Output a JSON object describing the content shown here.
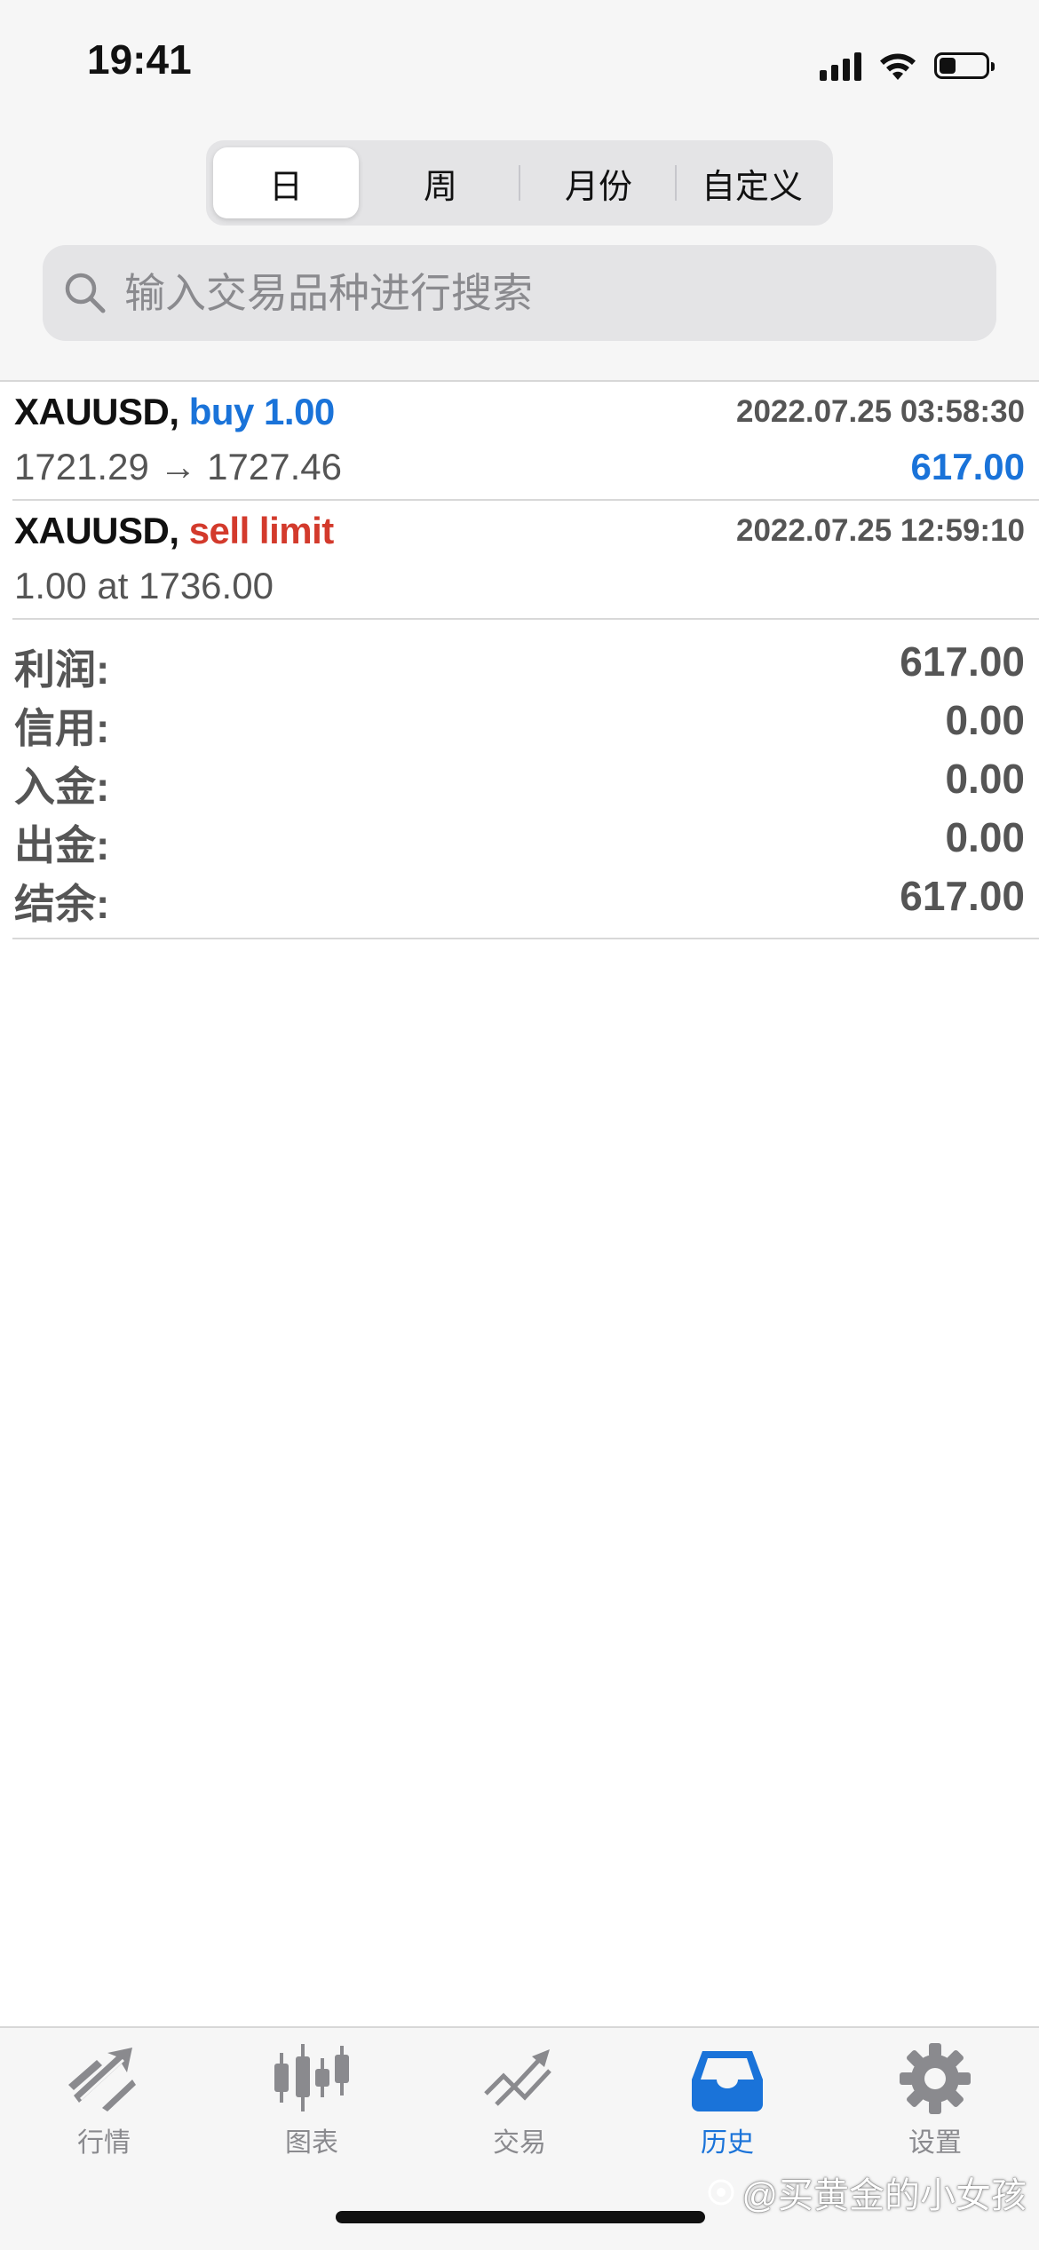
{
  "status_bar": {
    "time": "19:41",
    "battery_level": 0.35
  },
  "period_tabs": [
    {
      "label": "日",
      "active": true
    },
    {
      "label": "周",
      "active": false
    },
    {
      "label": "月份",
      "active": false
    },
    {
      "label": "自定义",
      "active": false
    }
  ],
  "search": {
    "placeholder": "输入交易品种进行搜索",
    "icon": "search-icon"
  },
  "trades": [
    {
      "symbol": "XAUUSD,",
      "side": "buy 1.00",
      "side_color": "#1a73d9",
      "datetime": "2022.07.25 03:58:30",
      "detail": "1721.29 → 1727.46",
      "profit": "617.00"
    },
    {
      "symbol": "XAUUSD,",
      "side": "sell limit",
      "side_color": "#d33a2c",
      "datetime": "2022.07.25 12:59:10",
      "detail": "1.00 at 1736.00",
      "profit": ""
    }
  ],
  "summary": [
    {
      "label": "利润:",
      "value": "617.00"
    },
    {
      "label": "信用:",
      "value": "0.00"
    },
    {
      "label": "入金:",
      "value": "0.00"
    },
    {
      "label": "出金:",
      "value": "0.00"
    },
    {
      "label": "结余:",
      "value": "617.00"
    }
  ],
  "tabbar": [
    {
      "label": "行情",
      "icon": "quotes-icon",
      "active": false
    },
    {
      "label": "图表",
      "icon": "chart-icon",
      "active": false
    },
    {
      "label": "交易",
      "icon": "trade-icon",
      "active": false
    },
    {
      "label": "历史",
      "icon": "history-icon",
      "active": true
    },
    {
      "label": "设置",
      "icon": "settings-icon",
      "active": false
    }
  ],
  "watermark": "@买黄金的小女孩",
  "colors": {
    "accent": "#1a73d9",
    "sell": "#d33a2c",
    "inactive": "#8a8a8e"
  }
}
